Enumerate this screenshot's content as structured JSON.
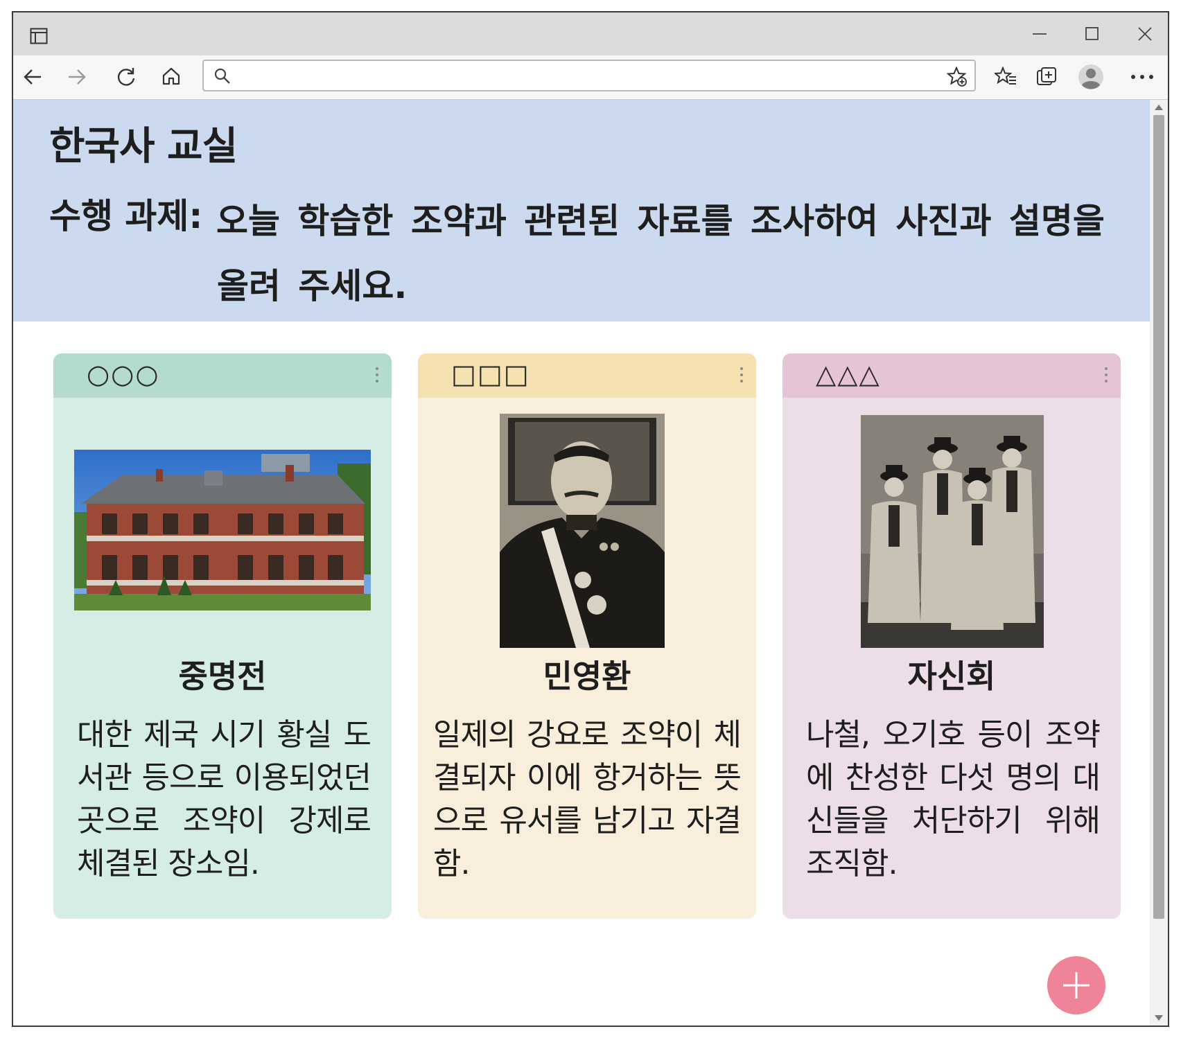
{
  "header": {
    "title": "한국사 교실",
    "assignment_label": "수행 과제:",
    "assignment_text": "오늘 학습한 조약과 관련된 자료를 조사하여 사진과 설명을 올려 주세요."
  },
  "cards": [
    {
      "author": "○○○",
      "title": "중명전",
      "text": "대한 제국 시기 황실 도서관 등으로 이용되었던 곳으로 조약이 강제로 체결된 장소임.",
      "image": "building-photo",
      "header_color": "#b3dccf",
      "body_color": "#d6ede6"
    },
    {
      "author": "□□□",
      "title": "민영환",
      "text": "일제의 강요로 조약이 체결되자 이에 항거하는 뜻으로 유서를 남기고 자결함.",
      "image": "portrait-photo",
      "header_color": "#f6e2b0",
      "body_color": "#f9eedb"
    },
    {
      "author": "△△△",
      "title": "자신회",
      "text": "나철, 오기호 등이 조약에 찬성한 다섯 명의 대신들을 처단하기 위해 조직함.",
      "image": "group-photo",
      "header_color": "#e5c4d6",
      "body_color": "#ecdde7"
    }
  ],
  "browser": {
    "address_value": "",
    "icons": [
      "tab-actions-icon",
      "back-icon",
      "forward-icon",
      "refresh-icon",
      "home-icon",
      "search-icon",
      "add-favorite-icon",
      "favorites-icon",
      "collections-icon",
      "profile-icon",
      "more-icon",
      "minimize-icon",
      "maximize-icon",
      "close-icon"
    ]
  },
  "colors": {
    "banner": "#ccdaf0",
    "fab": "#ef8398"
  },
  "fab_icon": "plus-icon"
}
